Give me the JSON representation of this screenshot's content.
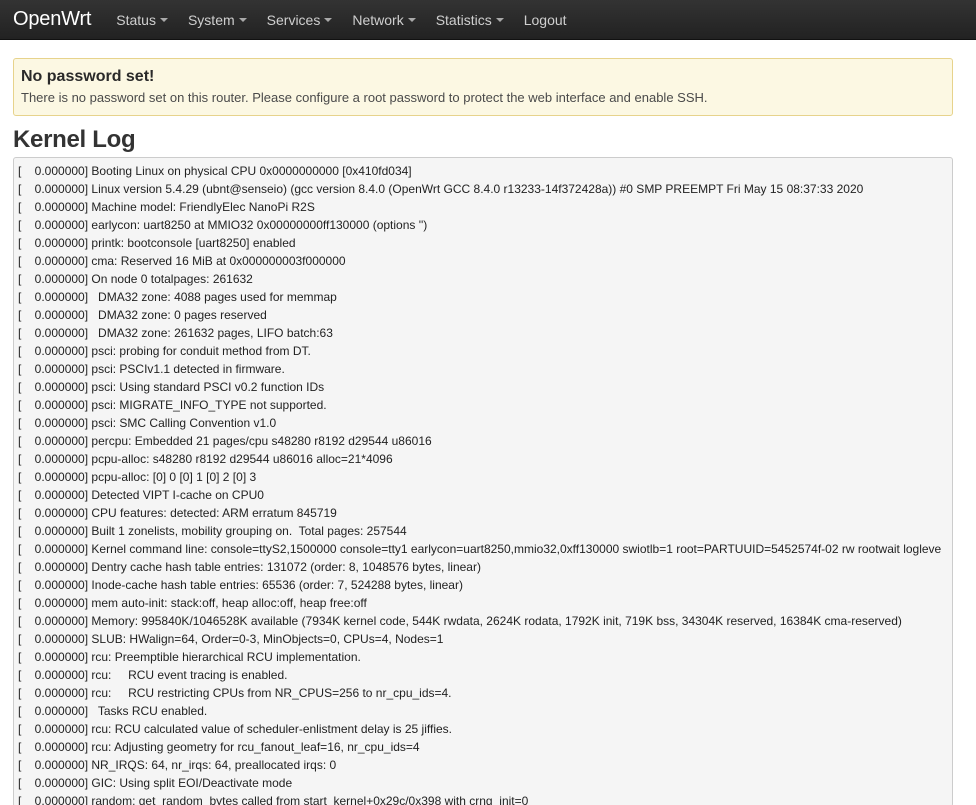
{
  "navbar": {
    "brand": "OpenWrt",
    "menu": [
      {
        "label": "Status",
        "dropdown": true
      },
      {
        "label": "System",
        "dropdown": true
      },
      {
        "label": "Services",
        "dropdown": true
      },
      {
        "label": "Network",
        "dropdown": true
      },
      {
        "label": "Statistics",
        "dropdown": true
      },
      {
        "label": "Logout",
        "dropdown": false
      }
    ]
  },
  "alert": {
    "title": "No password set!",
    "text": "There is no password set on this router. Please configure a root password to protect the web interface and enable SSH."
  },
  "page": {
    "title": "Kernel Log"
  },
  "log": {
    "lines": [
      "[    0.000000] Booting Linux on physical CPU 0x0000000000 [0x410fd034]",
      "[    0.000000] Linux version 5.4.29 (ubnt@senseio) (gcc version 8.4.0 (OpenWrt GCC 8.4.0 r13233-14f372428a)) #0 SMP PREEMPT Fri May 15 08:37:33 2020",
      "[    0.000000] Machine model: FriendlyElec NanoPi R2S",
      "[    0.000000] earlycon: uart8250 at MMIO32 0x00000000ff130000 (options '')",
      "[    0.000000] printk: bootconsole [uart8250] enabled",
      "[    0.000000] cma: Reserved 16 MiB at 0x000000003f000000",
      "[    0.000000] On node 0 totalpages: 261632",
      "[    0.000000]   DMA32 zone: 4088 pages used for memmap",
      "[    0.000000]   DMA32 zone: 0 pages reserved",
      "[    0.000000]   DMA32 zone: 261632 pages, LIFO batch:63",
      "[    0.000000] psci: probing for conduit method from DT.",
      "[    0.000000] psci: PSCIv1.1 detected in firmware.",
      "[    0.000000] psci: Using standard PSCI v0.2 function IDs",
      "[    0.000000] psci: MIGRATE_INFO_TYPE not supported.",
      "[    0.000000] psci: SMC Calling Convention v1.0",
      "[    0.000000] percpu: Embedded 21 pages/cpu s48280 r8192 d29544 u86016",
      "[    0.000000] pcpu-alloc: s48280 r8192 d29544 u86016 alloc=21*4096",
      "[    0.000000] pcpu-alloc: [0] 0 [0] 1 [0] 2 [0] 3",
      "[    0.000000] Detected VIPT I-cache on CPU0",
      "[    0.000000] CPU features: detected: ARM erratum 845719",
      "[    0.000000] Built 1 zonelists, mobility grouping on.  Total pages: 257544",
      "[    0.000000] Kernel command line: console=ttyS2,1500000 console=tty1 earlycon=uart8250,mmio32,0xff130000 swiotlb=1 root=PARTUUID=5452574f-02 rw rootwait logleve",
      "[    0.000000] Dentry cache hash table entries: 131072 (order: 8, 1048576 bytes, linear)",
      "[    0.000000] Inode-cache hash table entries: 65536 (order: 7, 524288 bytes, linear)",
      "[    0.000000] mem auto-init: stack:off, heap alloc:off, heap free:off",
      "[    0.000000] Memory: 995840K/1046528K available (7934K kernel code, 544K rwdata, 2624K rodata, 1792K init, 719K bss, 34304K reserved, 16384K cma-reserved)",
      "[    0.000000] SLUB: HWalign=64, Order=0-3, MinObjects=0, CPUs=4, Nodes=1",
      "[    0.000000] rcu: Preemptible hierarchical RCU implementation.",
      "[    0.000000] rcu:     RCU event tracing is enabled.",
      "[    0.000000] rcu:     RCU restricting CPUs from NR_CPUS=256 to nr_cpu_ids=4.",
      "[    0.000000]   Tasks RCU enabled.",
      "[    0.000000] rcu: RCU calculated value of scheduler-enlistment delay is 25 jiffies.",
      "[    0.000000] rcu: Adjusting geometry for rcu_fanout_leaf=16, nr_cpu_ids=4",
      "[    0.000000] NR_IRQS: 64, nr_irqs: 64, preallocated irqs: 0",
      "[    0.000000] GIC: Using split EOI/Deactivate mode",
      "[    0.000000] random: get_random_bytes called from start_kernel+0x29c/0x398 with crng_init=0"
    ]
  }
}
